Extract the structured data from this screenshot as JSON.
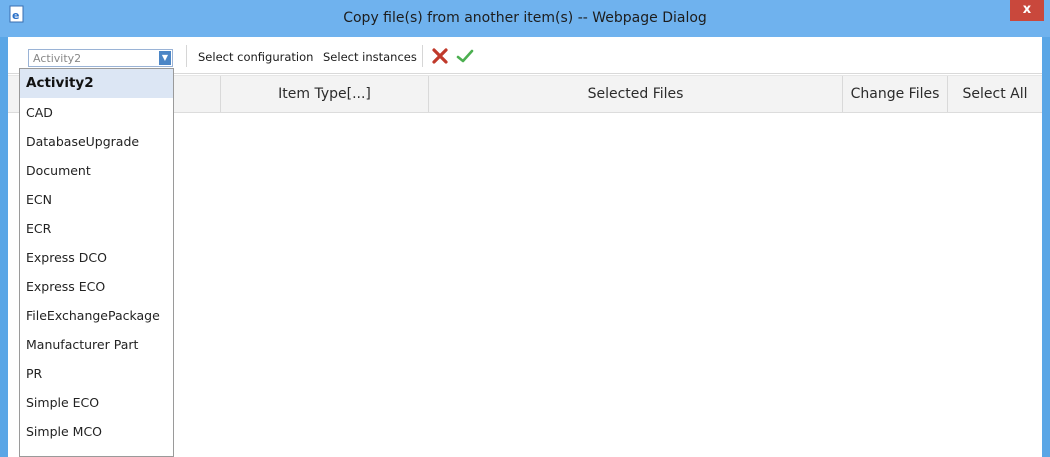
{
  "window": {
    "title": "Copy file(s) from another item(s) -- Webpage Dialog",
    "close_label": "x"
  },
  "toolbar": {
    "itemtype_select": {
      "selected": "Activity2"
    },
    "select_configuration_label": "Select configuration",
    "select_instances_label": "Select instances",
    "cancel_icon": "red-x-icon",
    "confirm_icon": "green-check-icon"
  },
  "grid": {
    "columns": [
      "",
      "Item Type[...]",
      "Selected Files",
      "Change Files",
      "Select All"
    ]
  },
  "dropdown": {
    "items": [
      "Activity2",
      "CAD",
      "DatabaseUpgrade",
      "Document",
      "ECN",
      "ECR",
      "Express DCO",
      "Express ECO",
      "FileExchangePackage",
      "Manufacturer Part",
      "PR",
      "Simple ECO",
      "Simple MCO"
    ],
    "selected_index": 0
  },
  "colors": {
    "titlebar": "#6fb2ee",
    "close_button": "#c9483c",
    "selected_item_bg": "#dce6f4",
    "cancel_icon": "#c0392b",
    "confirm_icon": "#4caf50"
  }
}
